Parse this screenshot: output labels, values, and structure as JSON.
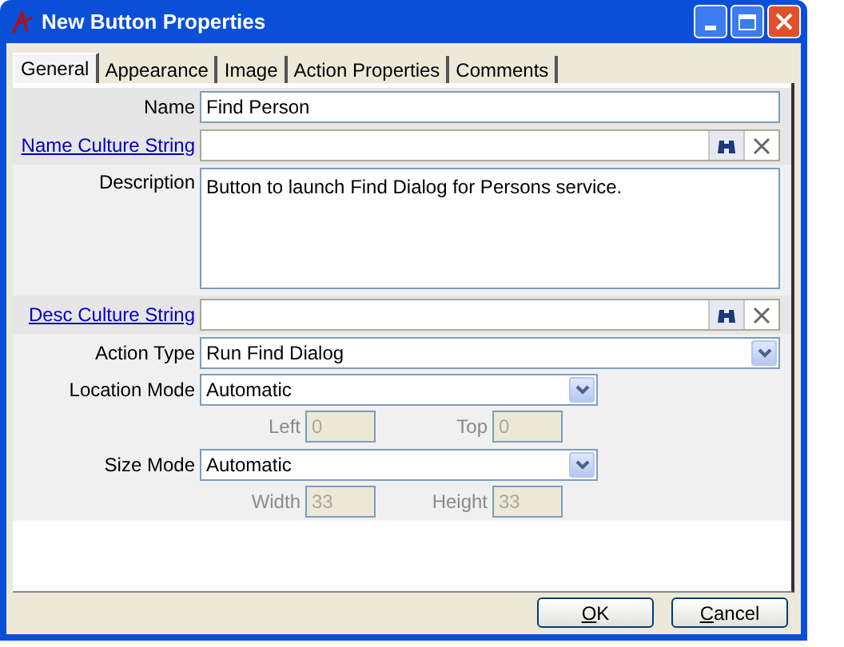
{
  "window": {
    "title": "New Button Properties"
  },
  "tabs": [
    {
      "label": "General",
      "selected": true
    },
    {
      "label": "Appearance",
      "selected": false
    },
    {
      "label": "Image",
      "selected": false
    },
    {
      "label": "Action Properties",
      "selected": false
    },
    {
      "label": "Comments",
      "selected": false
    }
  ],
  "fields": [
    {
      "kind": "text",
      "label": "Name",
      "value": "Find Person"
    },
    {
      "kind": "culture",
      "label": "Name Culture String"
    },
    {
      "kind": "textarea",
      "label": "Description",
      "value": "Button to launch Find Dialog for Persons service."
    },
    {
      "kind": "culture",
      "label": "Desc Culture String"
    },
    {
      "kind": "select",
      "label": "Action Type",
      "value": "Run Find Dialog",
      "wide": true
    },
    {
      "kind": "select",
      "label": "Location Mode",
      "value": "Automatic",
      "wide": false
    },
    {
      "kind": "pair",
      "items": [
        {
          "label": "Left",
          "value": "0",
          "disabled": true
        },
        {
          "label": "Top",
          "value": "0",
          "disabled": true
        }
      ]
    },
    {
      "kind": "select",
      "label": "Size Mode",
      "value": "Automatic",
      "wide": false
    },
    {
      "kind": "pair",
      "items": [
        {
          "label": "Width",
          "value": "33",
          "disabled": true
        },
        {
          "label": "Height",
          "value": "33",
          "disabled": true
        }
      ]
    }
  ],
  "buttons": [
    "OK",
    "Cancel"
  ]
}
